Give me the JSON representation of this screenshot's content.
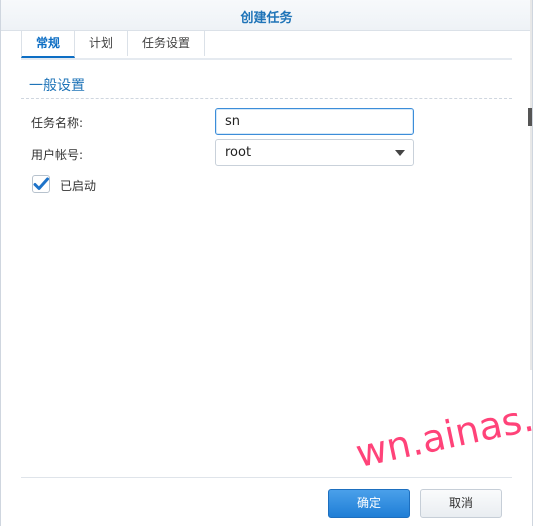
{
  "window": {
    "title": "创建任务"
  },
  "tabs": [
    {
      "label": "常规",
      "active": true
    },
    {
      "label": "计划",
      "active": false
    },
    {
      "label": "任务设置",
      "active": false
    }
  ],
  "section": {
    "title": "一般设置"
  },
  "form": {
    "task_name_label": "任务名称:",
    "task_name_value": "sn",
    "user_label": "用户帐号:",
    "user_value": "root",
    "enabled_label": "已启动",
    "enabled_checked": true
  },
  "buttons": {
    "ok": "确定",
    "cancel": "取消"
  },
  "watermark": "wn.ainas.cc",
  "colors": {
    "accent": "#1f74b8",
    "primary_button": "#1f7ed6",
    "watermark": "#ff2f6b"
  }
}
